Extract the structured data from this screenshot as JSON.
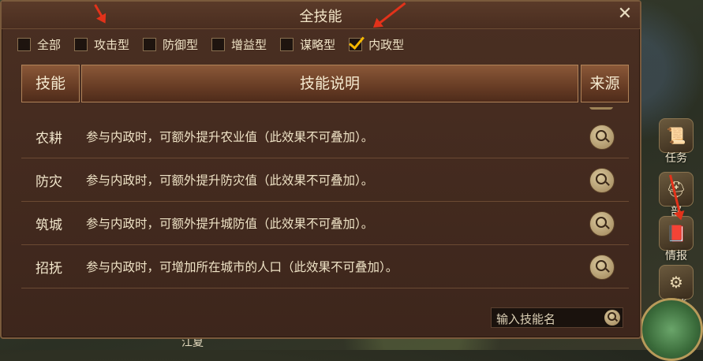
{
  "dialog": {
    "title": "全技能",
    "close_symbol": "✕"
  },
  "filters": [
    {
      "label": "全部",
      "checked": false
    },
    {
      "label": "攻击型",
      "checked": false
    },
    {
      "label": "防御型",
      "checked": false
    },
    {
      "label": "增益型",
      "checked": false
    },
    {
      "label": "谋略型",
      "checked": false
    },
    {
      "label": "内政型",
      "checked": true
    }
  ],
  "table": {
    "headers": [
      "技能",
      "技能说明",
      "来源"
    ],
    "rows": [
      {
        "name": "农耕",
        "desc": "参与内政时，可额外提升农业值（此效果不可叠加）。",
        "source_icon": "search-icon"
      },
      {
        "name": "防灾",
        "desc": "参与内政时，可额外提升防灾值（此效果不可叠加）。",
        "source_icon": "search-icon"
      },
      {
        "name": "筑城",
        "desc": "参与内政时，可额外提升城防值（此效果不可叠加）。",
        "source_icon": "search-icon"
      },
      {
        "name": "招抚",
        "desc": "参与内政时，可增加所在城市的人口（此效果不可叠加）。",
        "source_icon": "search-icon"
      }
    ]
  },
  "search": {
    "placeholder": "输入技能名"
  },
  "side_menu": [
    {
      "label": "任务",
      "icon": "scroll-icon"
    },
    {
      "label": "部",
      "icon": "helmet-icon"
    },
    {
      "label": "情报",
      "icon": "book-icon"
    },
    {
      "label": "功能",
      "icon": "gear-icon"
    }
  ],
  "background": {
    "city_label": "江夏"
  },
  "colors": {
    "check_accent": "#f5b800",
    "annotation_arrow": "#e2321a",
    "dialog_bg": "#4a2f22"
  }
}
